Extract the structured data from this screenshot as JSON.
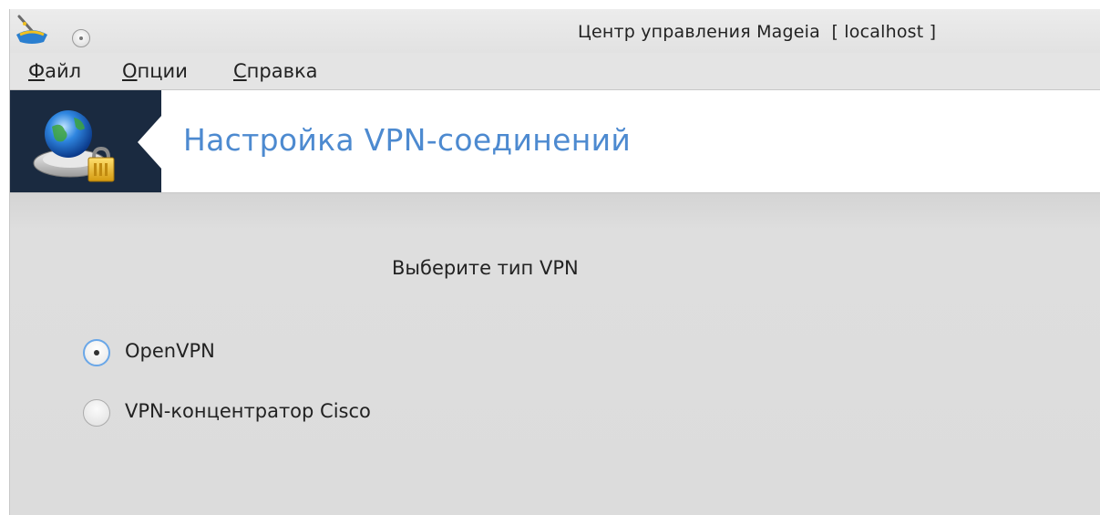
{
  "window": {
    "title": "Центр управления Mageia  [ localhost ]",
    "app_icon": "mageia-cauldron-icon"
  },
  "menubar": {
    "items": [
      {
        "accel": "Ф",
        "rest": "айл"
      },
      {
        "accel": "О",
        "rest": "пции"
      },
      {
        "accel": "С",
        "rest": "правка"
      }
    ]
  },
  "banner": {
    "title": "Настройка VPN-соединений",
    "icon": "vpn-globe-lock-icon",
    "colors": {
      "left_panel": "#1a2a40",
      "title": "#4d8ad0"
    }
  },
  "content": {
    "prompt": "Выберите тип VPN",
    "options": [
      {
        "label": "OpenVPN",
        "selected": true
      },
      {
        "label": "VPN-концентратор Cisco",
        "selected": false
      }
    ]
  }
}
